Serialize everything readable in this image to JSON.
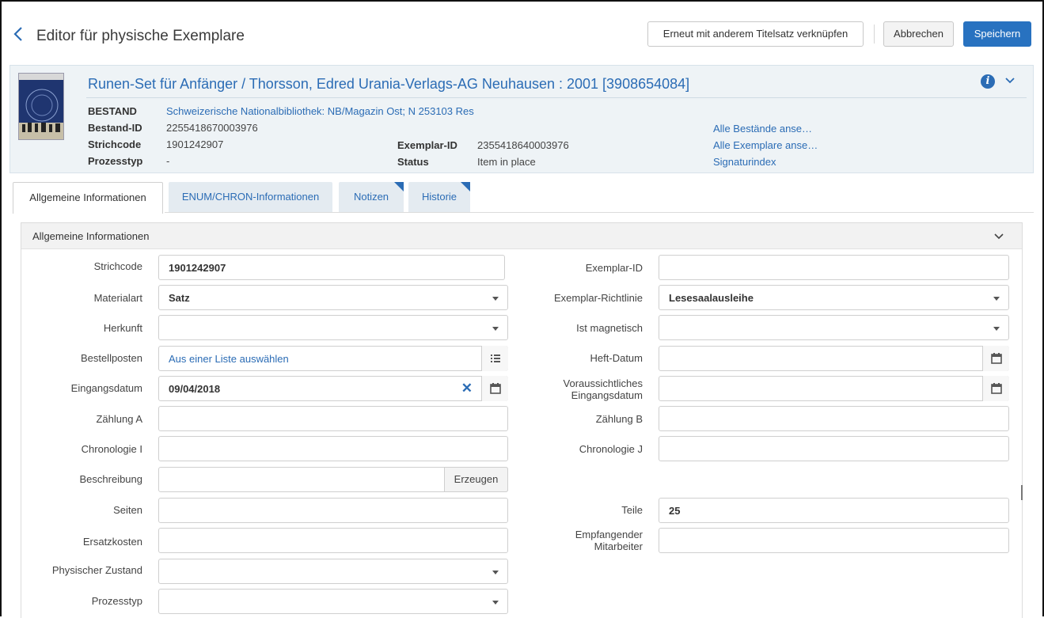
{
  "header": {
    "title": "Editor für physische Exemplare",
    "relink_label": "Erneut mit anderem Titelsatz verknüpfen",
    "cancel_label": "Abbrechen",
    "save_label": "Speichern"
  },
  "record": {
    "title": "Runen-Set für Anfänger / Thorsson, Edred Urania-Verlags-AG Neuhausen : 2001 [3908654084]",
    "cover_text": "Runen-Handbuch für Anfänger",
    "bestand_label": "BESTAND",
    "bestand_value": "Schweizerische Nationalbibliothek: NB/Magazin Ost; N 253103 Res",
    "bestand_id_label": "Bestand-ID",
    "bestand_id_value": "2255418670003976",
    "strichcode_label": "Strichcode",
    "strichcode_value": "1901242907",
    "prozesstyp_label": "Prozesstyp",
    "prozesstyp_value": "-",
    "exemplar_id_label": "Exemplar-ID",
    "exemplar_id_value": "2355418640003976",
    "status_label": "Status",
    "status_value": "Item in place",
    "link_bestaende": "Alle Bestände anse…",
    "link_exemplare": "Alle Exemplare anse…",
    "link_signaturindex": "Signaturindex"
  },
  "tabs": [
    {
      "label": "Allgemeine Informationen"
    },
    {
      "label": "ENUM/CHRON-Informationen"
    },
    {
      "label": "Notizen"
    },
    {
      "label": "Historie"
    }
  ],
  "section": {
    "title": "Allgemeine Informationen",
    "fields": {
      "strichcode": {
        "label": "Strichcode",
        "value": "1901242907"
      },
      "materialart": {
        "label": "Materialart",
        "value": "Satz"
      },
      "herkunft": {
        "label": "Herkunft",
        "value": ""
      },
      "bestellposten": {
        "label": "Bestellposten",
        "value": "Aus einer Liste auswählen"
      },
      "eingangsdatum": {
        "label": "Eingangsdatum",
        "value": "09/04/2018"
      },
      "zaehlung_a": {
        "label": "Zählung A",
        "value": ""
      },
      "chronologie_i": {
        "label": "Chronologie I",
        "value": ""
      },
      "beschreibung": {
        "label": "Beschreibung",
        "value": "",
        "button": "Erzeugen"
      },
      "seiten": {
        "label": "Seiten",
        "value": ""
      },
      "ersatzkosten": {
        "label": "Ersatzkosten",
        "value": ""
      },
      "physischer_zustand": {
        "label": "Physischer Zustand",
        "value": ""
      },
      "prozesstyp": {
        "label": "Prozesstyp",
        "value": ""
      },
      "exemplar_id": {
        "label": "Exemplar-ID",
        "value": ""
      },
      "exemplar_richtlinie": {
        "label": "Exemplar-Richtlinie",
        "value": "Lesesaalausleihe"
      },
      "ist_magnetisch": {
        "label": "Ist magnetisch",
        "value": ""
      },
      "heft_datum": {
        "label": "Heft-Datum",
        "value": ""
      },
      "voraussichtliches_line1": "Voraussichtliches",
      "voraussichtliches_line2": "Eingangsdatum",
      "voraussichtliches_value": "",
      "zaehlung_b": {
        "label": "Zählung B",
        "value": ""
      },
      "chronologie_j": {
        "label": "Chronologie J",
        "value": ""
      },
      "teile": {
        "label": "Teile",
        "value": "25"
      },
      "empfangender_line1": "Empfangender",
      "empfangender_line2": "Mitarbeiter",
      "empfangender_value": ""
    }
  },
  "colors": {
    "accent": "#2b6cb5",
    "save_button": "#2872c0",
    "record_background": "#eef3f6",
    "tab_inactive": "#e4ebf1"
  },
  "icons": {
    "back": "chevron-left-icon",
    "info": "info-icon",
    "collapse": "chevron-down-icon",
    "list": "list-icon",
    "calendar": "calendar-icon",
    "clear": "close-icon"
  }
}
